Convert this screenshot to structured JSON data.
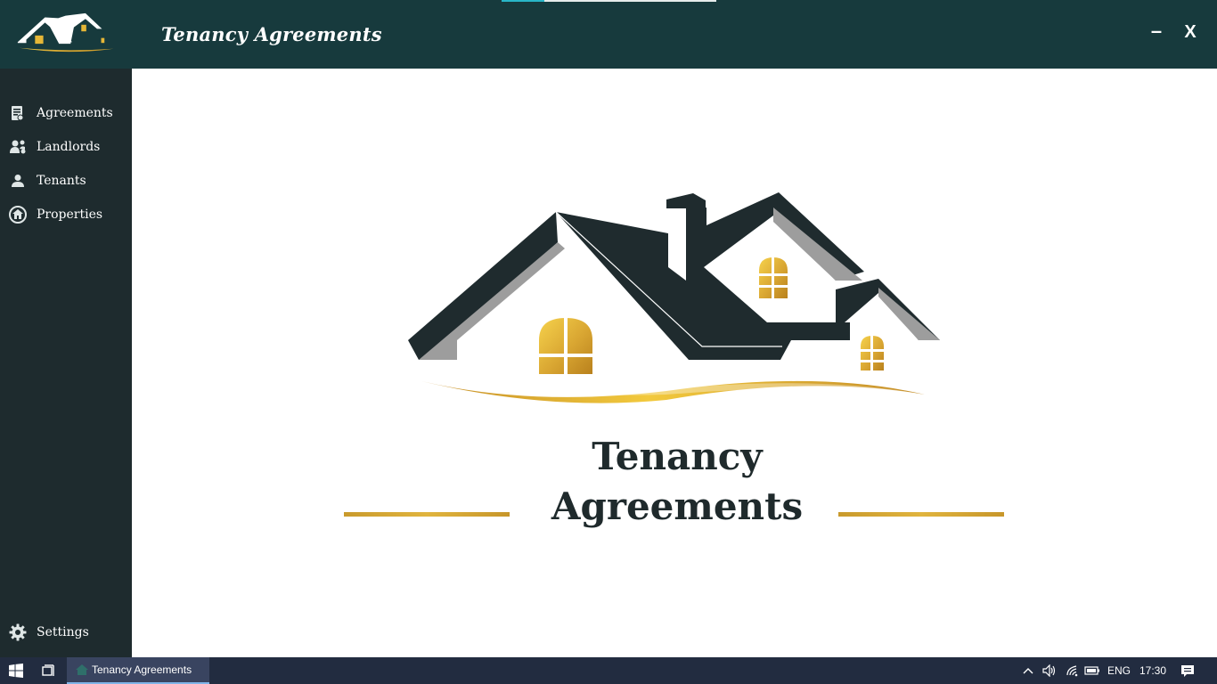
{
  "window": {
    "title": "Tenancy Agreements",
    "progress_fraction": 0.2,
    "minimize_label": "–",
    "close_label": "X"
  },
  "sidebar": {
    "items": [
      {
        "label": "Agreements",
        "icon": "agreement-icon"
      },
      {
        "label": "Landlords",
        "icon": "landlords-icon"
      },
      {
        "label": "Tenants",
        "icon": "tenant-icon"
      },
      {
        "label": "Properties",
        "icon": "property-icon"
      }
    ],
    "settings": {
      "label": "Settings",
      "icon": "gear-icon"
    }
  },
  "main": {
    "hero_title_line1": "Tenancy",
    "hero_title_line2": "Agreements"
  },
  "taskbar": {
    "app_label": "Tenancy Agreements",
    "language": "ENG",
    "time": "17:30",
    "icons": [
      "windows-start-icon",
      "task-view-icon",
      "chevron-up-icon",
      "volume-icon",
      "wifi-icon",
      "battery-icon",
      "notifications-icon"
    ]
  },
  "colors": {
    "titlebar": "#173a3d",
    "sidebar": "#1e2b2e",
    "gold": "#d4a536",
    "roof": "#1f2b2e",
    "taskbar": "#222c40"
  }
}
